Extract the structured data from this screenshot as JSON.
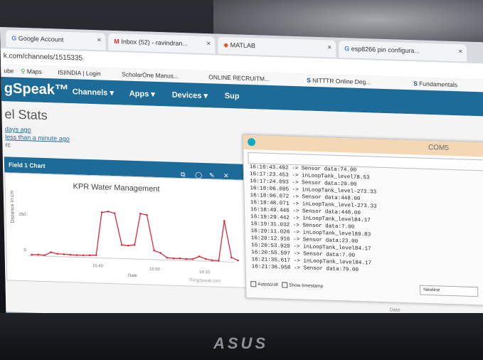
{
  "browser": {
    "tabs": [
      {
        "label": "Google Account",
        "icon": "google-icon"
      },
      {
        "label": "Inbox (52) - ravindran...",
        "icon": "gmail-icon"
      },
      {
        "label": "MATLAB",
        "icon": "matlab-icon"
      },
      {
        "label": "esp8266 pin configura...",
        "icon": "google-icon"
      }
    ],
    "url": "k.com/channels/1515335",
    "bookmarks": [
      "ube",
      "Maps",
      "ISIINDIA | Login",
      "ScholarOne Manus...",
      "ONLINE RECRUITM...",
      "NITTTR Online Deg...",
      "Fundamentals"
    ]
  },
  "navbar": {
    "brand": "gSpeak™",
    "items": [
      "Channels ▾",
      "Apps ▾",
      "Devices ▾",
      "Sup"
    ]
  },
  "page": {
    "title": "el Stats",
    "meta_created": "days ago",
    "meta_updated": "less than a minute ago",
    "meta_entries": "rc"
  },
  "field_chart": {
    "header": "Field 1 Chart",
    "chart_data": {
      "type": "line",
      "title": "KPR Water Management",
      "ylabel": "Distance in cm",
      "xlabel": "Date",
      "y_ticks": [
        "250",
        "0"
      ],
      "x_ticks": [
        "15:40",
        "15:50",
        "16:10"
      ],
      "source_label": "ThingSpeak.com",
      "color": "#d62d3e",
      "series": [
        {
          "values": [
            5,
            6,
            4,
            18,
            12,
            11,
            10,
            9,
            9,
            10,
            12,
            200,
            205,
            198,
            60,
            58,
            62,
            200,
            195,
            40,
            30,
            10,
            8,
            9,
            7,
            8,
            20,
            10,
            5,
            4,
            180,
            20,
            8
          ]
        }
      ]
    }
  },
  "coms": {
    "title": "COM5",
    "log": [
      "16:16:43.492 -> Sensor data:74.00",
      "16:17:23.453 -> inLoopTank_level78.53",
      "16:17:24.093 -> Sensor data:29.00",
      "16:18:06.095 -> inLoopTank_level-273.33",
      "16:18:06.072 -> Sensor data:448.00",
      "16:18:48.071 -> inLoopTank_level-273.33",
      "16:18:49.446 -> Sensor data:448.00",
      "16:19:29.442 -> inLoopTank_level84.17",
      "16:19:31.032 -> Sensor data:7.00",
      "16:20:11.026 -> inLoopTank_level80.83",
      "16:20:12.916 -> Sensor data:23.00",
      "16:20:53.920 -> inLoopTank_level84.17",
      "16:20:55.597 -> Sensor data:7.00",
      "16:21:35.617 -> inLoopTank_level84.17",
      "16:21:36.958 -> Sensor data:79.00"
    ],
    "autoscroll": "Autoscroll",
    "timestamp": "Show timestamp",
    "line_ending": "Newline"
  },
  "background_chart": {
    "xtick": "15:40",
    "xlabel": "Date"
  },
  "laptop_brand": "ASUS"
}
